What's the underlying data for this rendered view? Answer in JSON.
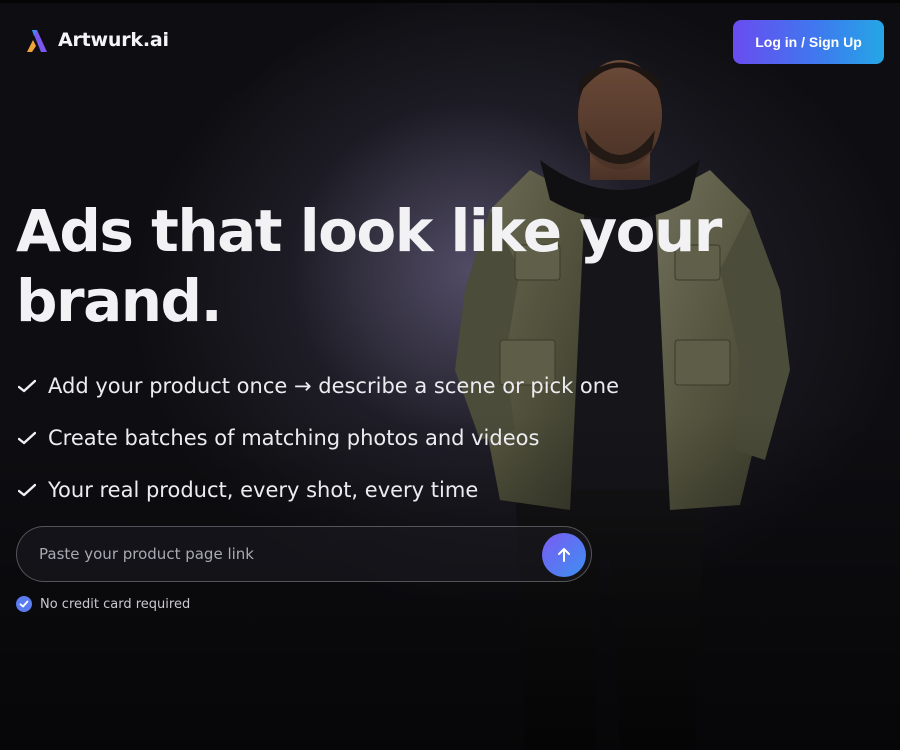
{
  "brand": {
    "name": "Artwurk.ai",
    "logo_colors": [
      "#f0a33a",
      "#7b57f2",
      "#3a8df0"
    ]
  },
  "header": {
    "login_label": "Log in / Sign Up"
  },
  "hero": {
    "headline_line1": "Ads that look like your",
    "headline_line2": "brand.",
    "features": [
      {
        "text": "Add your product once → describe a scene or pick one",
        "icon": "check-icon"
      },
      {
        "text": "Create batches of matching photos and videos",
        "icon": "check-icon"
      },
      {
        "text": "Your real product, every shot, every time",
        "icon": "check-icon"
      }
    ]
  },
  "url_form": {
    "placeholder": "Paste your product page link",
    "value": "",
    "submit_icon": "arrow-up-icon"
  },
  "note": {
    "text": "No credit card required",
    "icon": "verified-badge-icon"
  },
  "colors": {
    "accent_start": "#6a4cf0",
    "accent_end": "#24a7e6",
    "background": "#0d0d10"
  }
}
